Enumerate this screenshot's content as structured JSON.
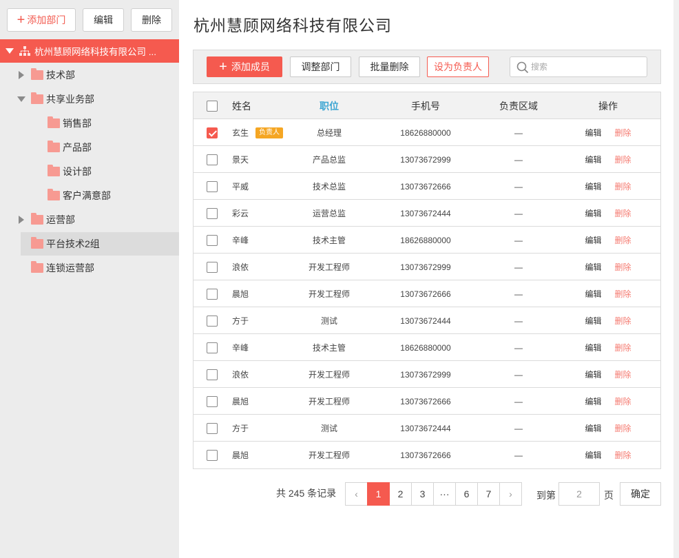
{
  "sidebar": {
    "add_label": "添加部门",
    "edit_label": "编辑",
    "delete_label": "删除",
    "root_label": "杭州慧顾网络科技有限公司 ...",
    "items": [
      {
        "label": "技术部",
        "expander": "collapsed"
      },
      {
        "label": "共享业务部",
        "expander": "expanded"
      },
      {
        "label": "销售部",
        "expander": "none"
      },
      {
        "label": "产品部",
        "expander": "none"
      },
      {
        "label": "设计部",
        "expander": "none"
      },
      {
        "label": "客户满意部",
        "expander": "none"
      },
      {
        "label": "运营部",
        "expander": "collapsed"
      },
      {
        "label": "平台技术2组",
        "expander": "none",
        "active": true
      },
      {
        "label": "连锁运营部",
        "expander": "none"
      }
    ]
  },
  "main": {
    "title": "杭州慧顾网络科技有限公司",
    "toolbar": {
      "add_member": "添加成员",
      "adjust_dept": "调整部门",
      "batch_delete": "批量删除",
      "set_leader": "设为负责人",
      "search_placeholder": "搜索"
    },
    "table": {
      "headers": {
        "name": "姓名",
        "position": "职位",
        "phone": "手机号",
        "area": "负责区域",
        "ops": "操作"
      },
      "edit_label": "编辑",
      "delete_label": "删除",
      "rows": [
        {
          "name": "玄生",
          "badge": "负责人",
          "position": "总经理",
          "phone": "18626880000",
          "area": "—",
          "checked": true
        },
        {
          "name": "景天",
          "position": "产品总监",
          "phone": "13073672999",
          "area": "—"
        },
        {
          "name": "平威",
          "position": "技术总监",
          "phone": "13073672666",
          "area": "—"
        },
        {
          "name": "彩云",
          "position": "运营总监",
          "phone": "13073672444",
          "area": "—"
        },
        {
          "name": "辛峰",
          "position": "技术主管",
          "phone": "18626880000",
          "area": "—"
        },
        {
          "name": "浪依",
          "position": "开发工程师",
          "phone": "13073672999",
          "area": "—"
        },
        {
          "name": "晨旭",
          "position": "开发工程师",
          "phone": "13073672666",
          "area": "—"
        },
        {
          "name": "方于",
          "position": "测试",
          "phone": "13073672444",
          "area": "—"
        },
        {
          "name": "辛峰",
          "position": "技术主管",
          "phone": "18626880000",
          "area": "—"
        },
        {
          "name": "浪依",
          "position": "开发工程师",
          "phone": "13073672999",
          "area": "—"
        },
        {
          "name": "晨旭",
          "position": "开发工程师",
          "phone": "13073672666",
          "area": "—"
        },
        {
          "name": "方于",
          "position": "测试",
          "phone": "13073672444",
          "area": "—"
        },
        {
          "name": "晨旭",
          "position": "开发工程师",
          "phone": "13073672666",
          "area": "—"
        }
      ]
    },
    "pagination": {
      "total_text": "共 245 条记录",
      "prev": "‹",
      "next": "›",
      "pages": [
        "1",
        "2",
        "3",
        "···",
        "6",
        "7"
      ],
      "current": "1",
      "goto_label": "到第",
      "goto_value": "2",
      "page_label": "页",
      "confirm_label": "确定"
    }
  },
  "colors": {
    "accent": "#f55a4f",
    "header_highlight": "#3ea6d3",
    "badge": "#f5a623"
  }
}
